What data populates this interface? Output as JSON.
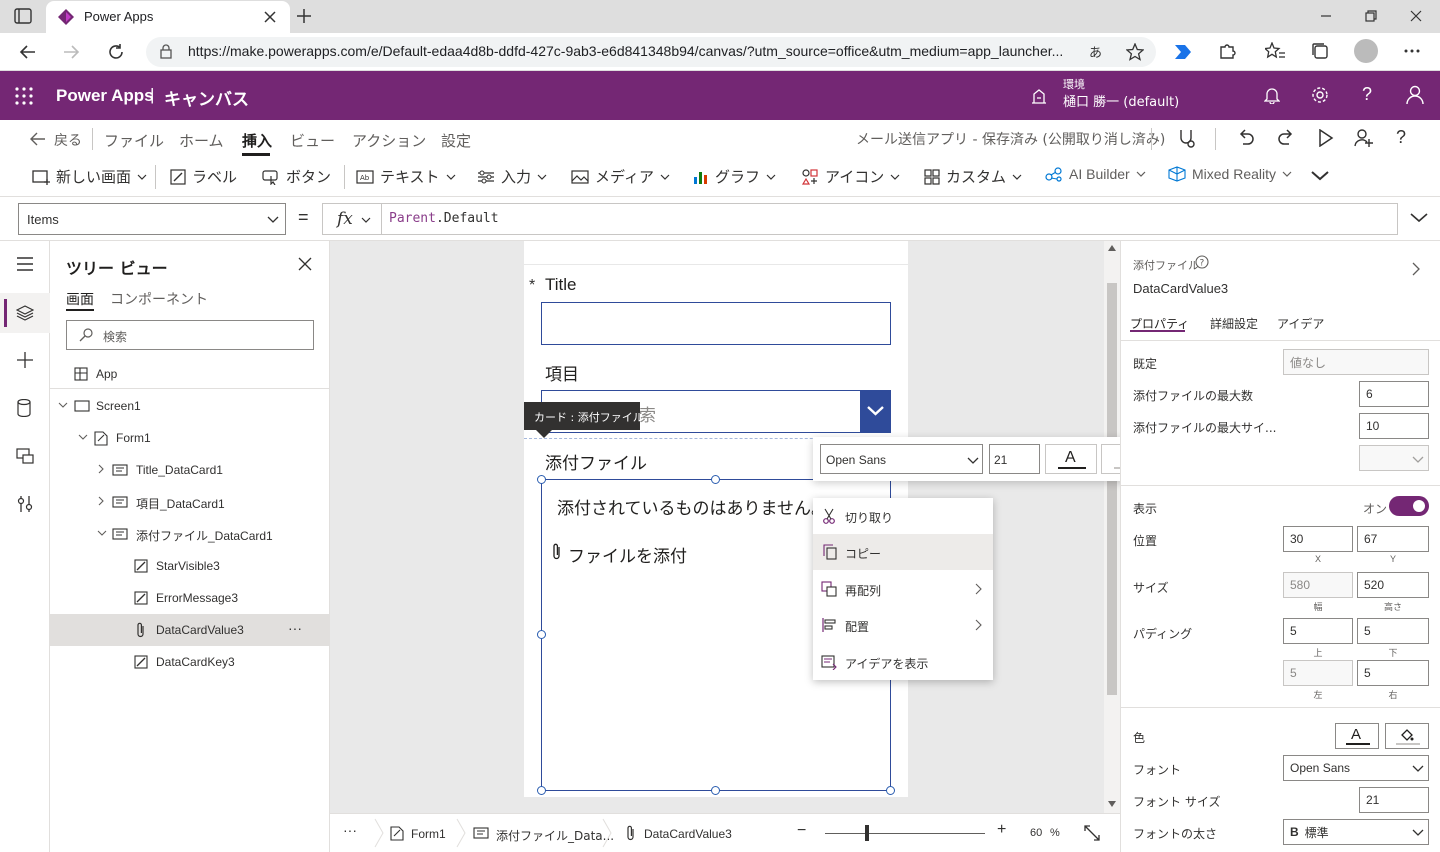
{
  "browser": {
    "tab_title": "Power Apps",
    "url": "https://make.powerapps.com/e/Default-edaa4d8b-ddfd-427c-9ab3-e6d841348b94/canvas/?utm_source=office&utm_medium=app_launcher...",
    "read_aloud": "あ",
    "brand_color": "#742774"
  },
  "suite": {
    "app_name": "Power Apps",
    "separator": "|",
    "page_name": "キャンバス",
    "env_label": "環境",
    "env_value": "樋口 勝一 (default)"
  },
  "command": {
    "back": "戻る",
    "file": "ファイル",
    "home": "ホーム",
    "insert": "挿入",
    "view": "ビュー",
    "action": "アクション",
    "settings": "設定",
    "status": "メール送信アプリ - 保存済み (公開取り消し済み)"
  },
  "ribbon": {
    "new_screen": "新しい画面",
    "label": "ラベル",
    "button": "ボタン",
    "text": "テキスト",
    "input": "入力",
    "media": "メディア",
    "chart": "グラフ",
    "icon": "アイコン",
    "custom": "カスタム",
    "ai_builder": "AI Builder",
    "mixed_reality": "Mixed Reality"
  },
  "formula": {
    "property": "Items",
    "equals": "=",
    "fx": "fx",
    "expr_obj": "Parent",
    "expr_rest": ".Default"
  },
  "tree": {
    "title": "ツリー ビュー",
    "tab_screens": "画面",
    "tab_components": "コンポーネント",
    "search_placeholder": "検索",
    "items": [
      {
        "label": "App",
        "icon": "app-icon"
      },
      {
        "label": "Screen1",
        "icon": "screen-icon"
      },
      {
        "label": "Form1",
        "icon": "form-icon"
      },
      {
        "label": "Title_DataCard1",
        "icon": "card-icon"
      },
      {
        "label": "項目_DataCard1",
        "icon": "card-icon"
      },
      {
        "label": "添付ファイル_DataCard1",
        "icon": "card-icon"
      },
      {
        "label": "StarVisible3",
        "icon": "edit-icon"
      },
      {
        "label": "ErrorMessage3",
        "icon": "edit-icon"
      },
      {
        "label": "DataCardValue3",
        "icon": "paperclip-icon"
      },
      {
        "label": "DataCardKey3",
        "icon": "edit-icon"
      }
    ],
    "more": "···"
  },
  "canvas": {
    "star": "*",
    "title_label": "Title",
    "item_label": "項目",
    "item_placeholder": "検索",
    "tooltip": "カード : 添付ファイル",
    "attach_label": "添付ファイル",
    "no_attachments": "添付されているものはありません。",
    "attach_file": "ファイルを添付"
  },
  "format_toolbar": {
    "font": "Open Sans",
    "size": "21",
    "letter_a": "A"
  },
  "context_menu": {
    "cut": "切り取り",
    "copy": "コピー",
    "reorder": "再配列",
    "align": "配置",
    "ideas": "アイデアを表示"
  },
  "bottom": {
    "more": "···",
    "crumb1": "Form1",
    "crumb2": "添付ファイル_Data...",
    "crumb3": "DataCardValue3",
    "minus": "−",
    "plus": "+",
    "zoom": "60",
    "percent": "%",
    "zoom_level": 0.6
  },
  "props": {
    "type": "添付ファイル",
    "name": "DataCardValue3",
    "tab_props": "プロパティ",
    "tab_advanced": "詳細設定",
    "tab_ideas": "アイデア",
    "default_label": "既定",
    "default_value": "値なし",
    "max_attach_label": "添付ファイルの最大数",
    "max_attach_value": "6",
    "max_size_label": "添付ファイルの最大サイ...",
    "max_size_value": "10",
    "visible_label": "表示",
    "visible_value": "オン",
    "pos_label": "位置",
    "pos_x": "30",
    "pos_y": "67",
    "cap_x": "X",
    "cap_y": "Y",
    "size_label": "サイズ",
    "size_w": "580",
    "size_h": "520",
    "cap_w": "幅",
    "cap_h": "高さ",
    "padding_label": "パディング",
    "pad_top": "5",
    "pad_bottom": "5",
    "pad_left": "5",
    "pad_right": "5",
    "cap_top": "上",
    "cap_bottom": "下",
    "cap_left": "左",
    "cap_right": "右",
    "color_label": "色",
    "font_label": "フォント",
    "font_value": "Open Sans",
    "font_size_label": "フォント サイズ",
    "font_size_value": "21",
    "font_weight_label": "フォントの太さ",
    "font_weight_value": "標準",
    "font_weight_b": "B",
    "letter_a": "A"
  }
}
